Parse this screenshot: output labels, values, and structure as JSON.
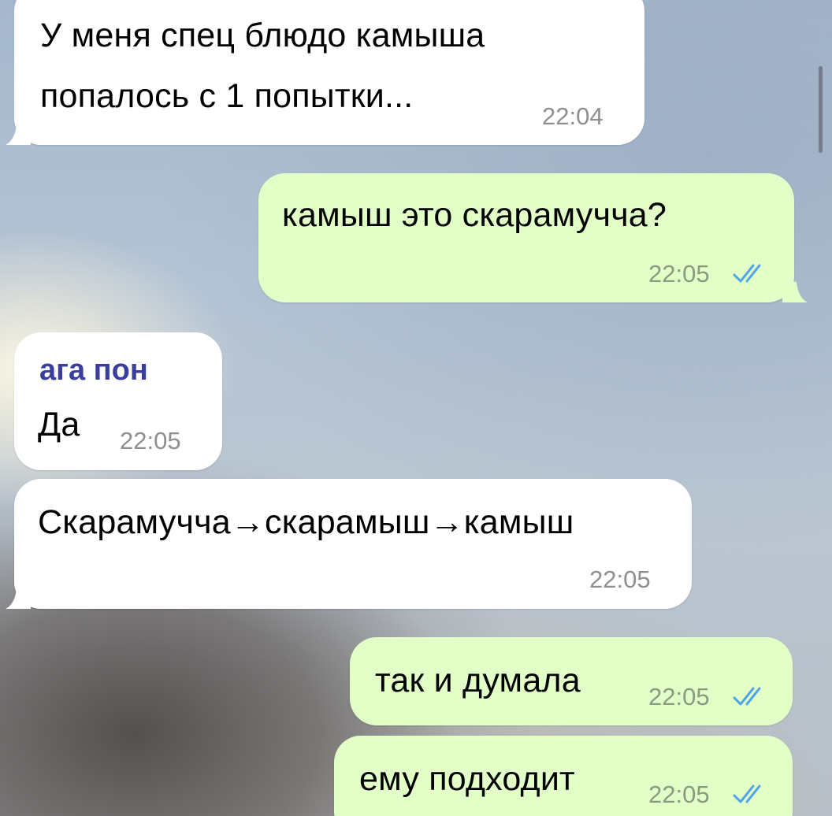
{
  "messages": [
    {
      "direction": "incoming",
      "lines": [
        "У меня спец блюдо камыша",
        "попалось с 1 попытки..."
      ],
      "time": "22:04"
    },
    {
      "direction": "outgoing",
      "lines": [
        "камыш это скарамучча?"
      ],
      "time": "22:05",
      "status": "read"
    },
    {
      "direction": "incoming",
      "reply_to": "ага пон",
      "lines": [
        "Да"
      ],
      "time": "22:05"
    },
    {
      "direction": "incoming",
      "lines": [
        "Скарамучча→скарамыш→камыш"
      ],
      "time": "22:05"
    },
    {
      "direction": "outgoing",
      "lines": [
        "так и думала"
      ],
      "time": "22:05",
      "status": "read"
    },
    {
      "direction": "outgoing",
      "lines": [
        "ему подходит"
      ],
      "time": "22:05",
      "status": "read"
    }
  ],
  "colors": {
    "incoming_bubble": "#ffffff",
    "outgoing_bubble": "#e1ffc7",
    "sender_name": "#3a3f9e",
    "read_checks": "#4fa3e8"
  },
  "icons": {
    "read_status": "double-check-icon"
  }
}
